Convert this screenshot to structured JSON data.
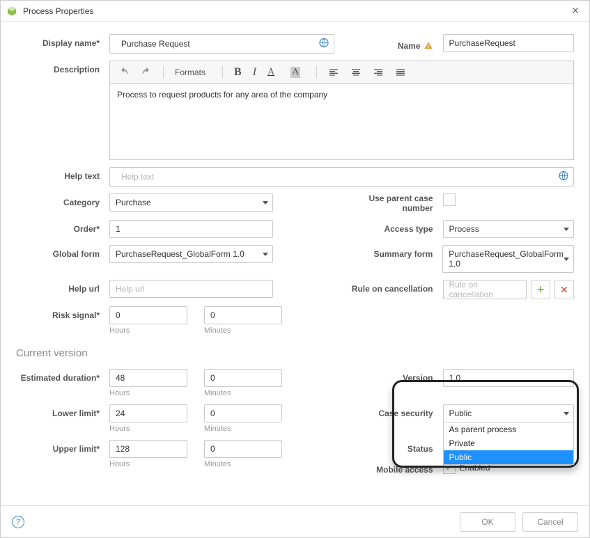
{
  "dialog": {
    "title": "Process Properties"
  },
  "labels": {
    "display_name": "Display name*",
    "name": "Name",
    "description": "Description",
    "help_text": "Help text",
    "category": "Category",
    "use_parent_case_number": "Use parent case number",
    "order": "Order*",
    "access_type": "Access type",
    "global_form": "Global form",
    "summary_form": "Summary form",
    "help_url": "Help url",
    "rule_on_cancel": "Rule on cancellation",
    "risk_signal": "Risk signal*",
    "hours": "Hours",
    "minutes": "Minutes",
    "section_current_version": "Current version",
    "estimated_duration": "Estimated duration*",
    "lower_limit": "Lower limit*",
    "upper_limit": "Upper limit*",
    "version": "Version",
    "case_security": "Case security",
    "status": "Status",
    "mobile_access": "Mobile access",
    "enabled": "Enabled"
  },
  "toolbar": {
    "formats_label": "Formats"
  },
  "values": {
    "display_name": "Purchase Request",
    "name": "PurchaseRequest",
    "description": "Process to request products for any area of the company",
    "help_text_placeholder": "Help text",
    "category": "Purchase",
    "order": "1",
    "access_type": "Process",
    "global_form": "PurchaseRequest_GlobalForm 1.0",
    "summary_form": "PurchaseRequest_GlobalForm 1.0",
    "help_url_placeholder": "Help url",
    "rule_on_cancel_placeholder": "Rule on cancellation",
    "risk_hours": "0",
    "risk_minutes": "0",
    "est_hours": "48",
    "est_minutes": "0",
    "lower_hours": "24",
    "lower_minutes": "0",
    "upper_hours": "128",
    "upper_minutes": "0",
    "version": "1.0",
    "case_security_selected": "Public",
    "case_security_options": [
      "As parent process",
      "Private",
      "Public"
    ]
  },
  "footer": {
    "ok": "OK",
    "cancel": "Cancel"
  }
}
